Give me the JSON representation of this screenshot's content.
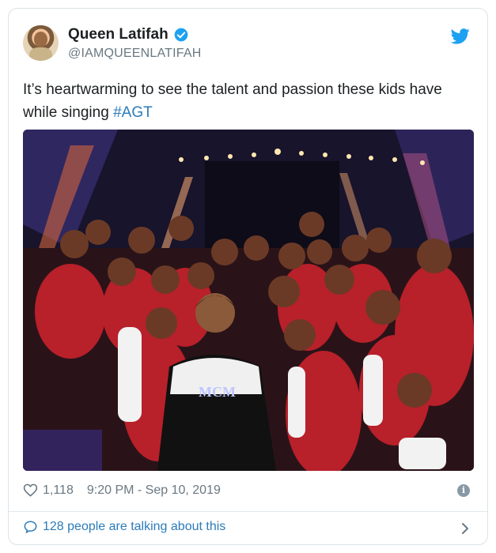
{
  "tweet": {
    "author": {
      "name": "Queen Latifah",
      "handle": "@IAMQUEENLATIFAH",
      "verified": true
    },
    "text_line1": "It’s heartwarming to see the talent and passion these kids have",
    "text_line2_prefix": "while singing ",
    "hashtag": "#AGT",
    "photo_alt": "photo",
    "likes": "1,118",
    "timestamp": "9:20 PM - Sep 10, 2019",
    "conversation": "128 people are talking about this"
  },
  "colors": {
    "link": "#2b7bb9",
    "twitter_blue": "#1da1f2",
    "muted": "#697882",
    "text": "#1c2022",
    "border": "#dbe2e6"
  },
  "icons": {
    "verified": "verified-badge-icon",
    "bird": "twitter-bird-icon",
    "heart": "heart-icon",
    "info": "info-icon",
    "bubble": "speech-bubble-icon",
    "chevron": "chevron-right-icon"
  }
}
